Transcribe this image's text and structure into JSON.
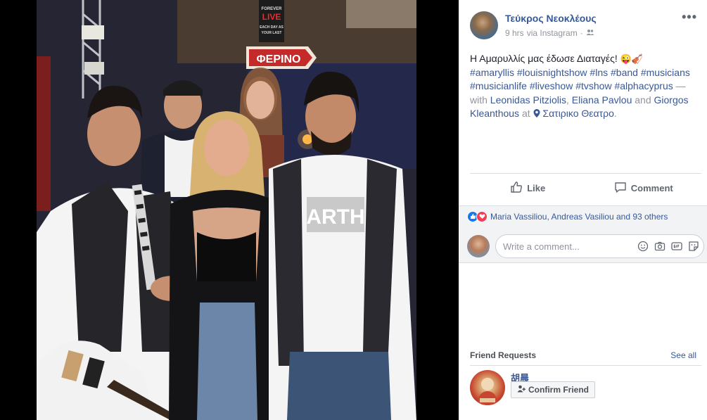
{
  "post": {
    "author": "Τεύκρος Νεοκλέους",
    "time": "9 hrs",
    "via": "via Instagram",
    "more_label": "•••",
    "text_main": "Η Αμαρυλλίς μας έδωσε Διαταγές! ",
    "hashtags": [
      "#amaryllis",
      "#louisnightshow",
      "#lns",
      "#band",
      "#musicians",
      "#musicianlife",
      "#liveshow",
      "#tvshow",
      "#alphacyprus"
    ],
    "with_prefix": " — with ",
    "people": [
      "Leonidas Pitziolis",
      "Eliana Pavlou",
      "Giorgos Kleanthous"
    ],
    "sep_comma": ", ",
    "sep_and": " and ",
    "at_word": " at ",
    "place": "Σατιρικο Θεατρο",
    "period": ".",
    "photo_signs": {
      "forever_live": [
        "FOREVER",
        "LIVE",
        "EACH DAY AS",
        "YOUR LAST"
      ],
      "arrow_sign": "ΦΕΡΙΝΟ",
      "shirt_text": "ARTH"
    }
  },
  "actions": {
    "like": "Like",
    "comment": "Comment"
  },
  "reactions": {
    "text": "Maria Vassiliou, Andreas Vasiliou and 93 others"
  },
  "comment_input": {
    "placeholder": "Write a comment..."
  },
  "friend_requests": {
    "title": "Friend Requests",
    "see_all": "See all",
    "name": "胡晨",
    "confirm_label": "Confirm Friend"
  },
  "colors": {
    "link": "#385898",
    "like_blue": "#1877f2",
    "love_red": "#f33e58"
  }
}
